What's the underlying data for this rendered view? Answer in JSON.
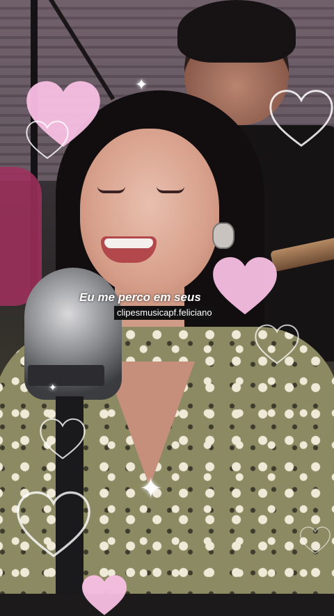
{
  "video": {
    "caption": "Eu me perco em seus",
    "watermark": "clipesmusicapf.feliciano"
  },
  "overlays": {
    "heart_fill_color": "#f8bfe4",
    "heart_outline_color": "#ffffff",
    "caption_color": "#ffffff",
    "watermark_bg": "#111111"
  }
}
